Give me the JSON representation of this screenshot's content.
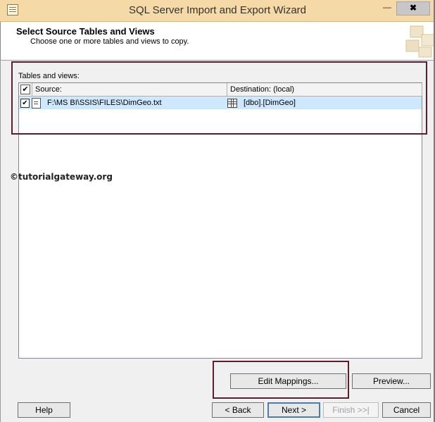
{
  "window": {
    "title": "SQL Server Import and Export Wizard",
    "minimize_glyph": "—",
    "close_glyph": "✖"
  },
  "header": {
    "title": "Select Source Tables and Views",
    "subtitle": "Choose one or more tables and views to copy."
  },
  "tables": {
    "label": "Tables and views:",
    "columns": {
      "source": "Source:",
      "destination": "Destination: (local)"
    },
    "rows": [
      {
        "checked": true,
        "source": "F:\\MS BI\\SSIS\\FILES\\DimGeo.txt",
        "destination": "[dbo].[DimGeo]"
      }
    ]
  },
  "watermark": "©tutorialgateway.org",
  "buttons": {
    "edit_mappings": "Edit Mappings...",
    "preview": "Preview...",
    "help": "Help",
    "back": "< Back",
    "next": "Next >",
    "finish": "Finish >>|",
    "cancel": "Cancel"
  },
  "colors": {
    "titlebar": "#f5d9a6",
    "row_selected": "#cde8ff",
    "highlight_box": "#5c1e2c"
  }
}
